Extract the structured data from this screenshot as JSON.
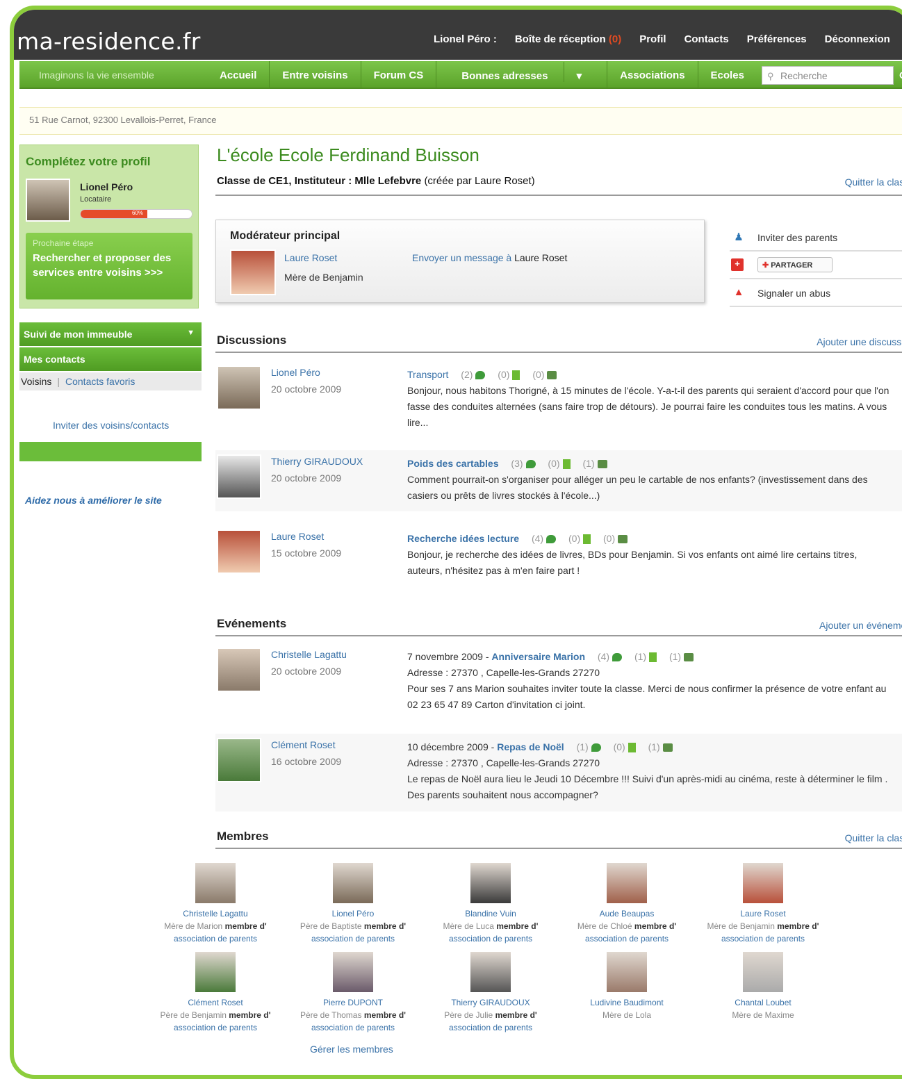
{
  "header": {
    "logo": "ma-residence.fr",
    "user_label": "Lionel Péro :",
    "inbox_label": "Boîte de réception",
    "inbox_count": "(0)",
    "profile": "Profil",
    "contacts": "Contacts",
    "preferences": "Préférences",
    "logout": "Déconnexion"
  },
  "nav": {
    "tagline": "Imaginons la vie ensemble",
    "items": [
      "Accueil",
      "Entre voisins",
      "Forum CS",
      "Bonnes adresses",
      "Associations",
      "Ecoles"
    ],
    "search_placeholder": "Recherche",
    "search_ok": "OK"
  },
  "address": "51 Rue Carnot, 92300 Levallois-Perret, France",
  "sidebar": {
    "profile_title": "Complétez votre profil",
    "user_name": "Lionel Péro",
    "user_role": "Locataire",
    "progress_label": "60%",
    "progress_value": 0.6,
    "next_label": "Prochaine étape",
    "next_link": "Rechercher et proposer des services entre voisins >>>",
    "menu_building": "Suivi de mon immeuble",
    "menu_contacts": "Mes contacts",
    "tab_neighbors": "Voisins",
    "tab_favorites": "Contacts favoris",
    "invite_link": "Inviter des voisins/contacts",
    "improve_link": "Aidez nous à améliorer le site"
  },
  "page": {
    "title": "L'école Ecole Ferdinand Buisson",
    "class_bold": "Classe de CE1, Instituteur : Mlle Lefebvre",
    "class_light": "(créée par Laure Roset)",
    "quit_class": "Quitter la classe"
  },
  "moderator": {
    "title": "Modérateur principal",
    "name": "Laure Roset",
    "subtitle": "Mère de Benjamin",
    "message_link": "Envoyer un message à",
    "message_name": "Laure Roset"
  },
  "actions": {
    "invite": "Inviter des parents",
    "share": "PARTAGER",
    "report": "Signaler un abus"
  },
  "discussions": {
    "heading": "Discussions",
    "add": "Ajouter une discussion",
    "items": [
      {
        "author": "Lionel Péro",
        "date": "20 octobre 2009",
        "title": "Transport",
        "comments": "(2)",
        "docs": "(0)",
        "photos": "(0)",
        "text": "Bonjour, nous habitons Thorigné, à 15 minutes de l'école. Y-a-t-il des parents qui seraient d'accord pour que l'on fasse des conduites alternées (sans faire trop de détours). Je pourrai faire les conduites tous les matins. A vous lire...",
        "avatar": "#7a6a58"
      },
      {
        "author": "Thierry GIRAUDOUX",
        "date": "20 octobre 2009",
        "title": "Poids des cartables",
        "comments": "(3)",
        "docs": "(0)",
        "photos": "(1)",
        "text": "Comment pourrait-on s'organiser pour alléger un peu le cartable de nos enfants? (investissement dans des casiers ou prêts de livres stockés à l'école...)",
        "avatar": "#555555"
      },
      {
        "author": "Laure Roset",
        "date": "15 octobre 2009",
        "title": "Recherche idées lecture",
        "comments": "(4)",
        "docs": "(0)",
        "photos": "(0)",
        "text": "Bonjour, je recherche des idées de livres, BDs pour Benjamin. Si vos enfants ont aimé lire certains titres, auteurs, n'hésitez pas à m'en faire part !",
        "avatar": "#b8503a"
      }
    ]
  },
  "events": {
    "heading": "Evénements",
    "add": "Ajouter un événement",
    "items": [
      {
        "author": "Christelle Lagattu",
        "date": "20 octobre 2009",
        "event_date": "7 novembre 2009 -",
        "title": "Anniversaire Marion",
        "comments": "(4)",
        "docs": "(1)",
        "photos": "(1)",
        "address": "Adresse : 27370 , Capelle-les-Grands 27270",
        "text": "Pour ses 7 ans Marion souhaites inviter toute la classe. Merci de nous confirmer la présence de votre enfant au 02 23 65 47 89 Carton d'invitation ci joint.",
        "avatar": "#8a7a6a"
      },
      {
        "author": "Clément Roset",
        "date": "16 octobre 2009",
        "event_date": "10 décembre 2009 -",
        "title": "Repas de Noël",
        "comments": "(1)",
        "docs": "(0)",
        "photos": "(1)",
        "address": "Adresse : 27370 , Capelle-les-Grands 27270",
        "text": "Le repas de Noël aura lieu le Jeudi 10 Décembre !!! Suivi d'un après-midi au cinéma, reste à déterminer le film . Des parents souhaitent nous accompagner?",
        "avatar": "#4a7a3a"
      }
    ]
  },
  "members": {
    "heading": "Membres",
    "quit": "Quitter la classe",
    "member_word": "membre d'",
    "assoc_word": "association de parents",
    "manage": "Gérer les membres",
    "items": [
      {
        "name": "Christelle Lagattu",
        "role": "Mère de Marion",
        "assoc": true,
        "color": "#8a7a6a"
      },
      {
        "name": "Lionel Péro",
        "role": "Père de Baptiste",
        "assoc": true,
        "color": "#7a6a58"
      },
      {
        "name": "Blandine Vuin",
        "role": "Mère de Luca",
        "assoc": true,
        "color": "#3a3a3a"
      },
      {
        "name": "Aude Beaupas",
        "role": "Mère de Chloé",
        "assoc": true,
        "color": "#a0604a"
      },
      {
        "name": "Laure Roset",
        "role": "Mère de Benjamin",
        "assoc": true,
        "color": "#b8503a"
      },
      {
        "name": "Clément Roset",
        "role": "Père de Benjamin",
        "assoc": true,
        "color": "#4a7a3a"
      },
      {
        "name": "Pierre DUPONT",
        "role": "Père de Thomas",
        "assoc": true,
        "color": "#6a5a6a"
      },
      {
        "name": "Thierry GIRAUDOUX",
        "role": "Père de Julie",
        "assoc": true,
        "color": "#555555"
      },
      {
        "name": "Ludivine Baudimont",
        "role": "Mère de Lola",
        "assoc": false,
        "color": "#9a7a6a"
      },
      {
        "name": "Chantal Loubet",
        "role": "Mère de Maxime",
        "assoc": false,
        "color": "#aaaaaa"
      }
    ]
  }
}
